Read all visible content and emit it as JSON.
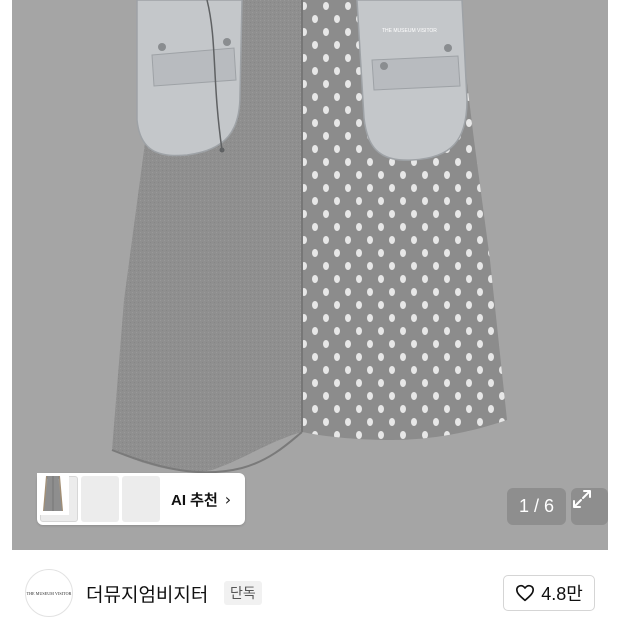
{
  "product_image": {
    "slide_current": "1",
    "slide_total": "6",
    "counter_text": "1 / 6",
    "pocket_logo_text": "THE MUSEUM VISITOR"
  },
  "recommendation": {
    "label": "AI 추천",
    "thumbnail_count": 3
  },
  "brand": {
    "logo_text": "THE MUSEUM VISITOR",
    "name": "더뮤지엄비지터",
    "badge": "단독"
  },
  "like": {
    "count": "4.8만"
  },
  "colors": {
    "background": "#a5a5a5",
    "overlay": "#8e8e8e",
    "skirt_gray": "#8f8f8f",
    "pocket_gray": "#c4c7ca"
  },
  "icons": {
    "expand": "expand-icon",
    "chevron": "chevron-right-icon",
    "heart": "heart-icon"
  }
}
